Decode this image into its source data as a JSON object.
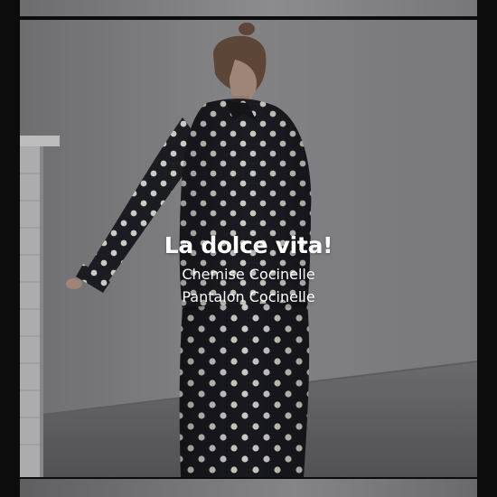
{
  "caption": {
    "title": "La dolce vita!",
    "line1": "Chemise Cocinelle",
    "line2": "Pantalon Cocinelle"
  },
  "colors": {
    "frame": "#0c0c0d",
    "wall": "#8d8d90",
    "floor": "#6f6f72",
    "garment": "#1f1f27",
    "dots": "#e9e6e0",
    "hair": "#6a5040",
    "skin": "#b49888",
    "caption_text": "#ffffff"
  },
  "icons": []
}
